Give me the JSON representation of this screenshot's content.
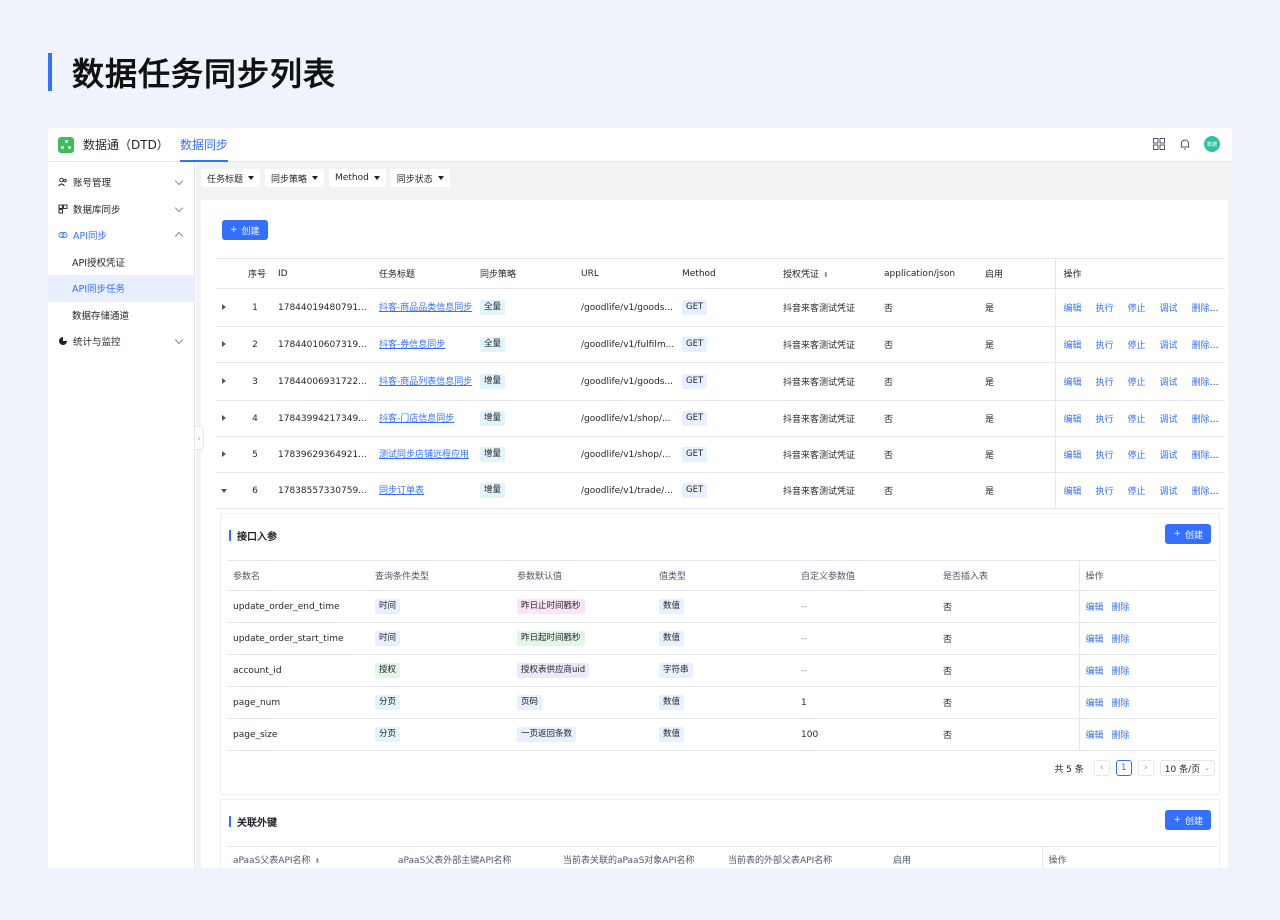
{
  "page_title": "数据任务同步列表",
  "app": {
    "name": "数据通（DTD）",
    "active_tab": "数据同步",
    "avatar_text": "数据"
  },
  "sidebar": {
    "items": [
      {
        "label": "账号管理",
        "icon": "users-icon",
        "expandable": true
      },
      {
        "label": "数据库同步",
        "icon": "database-icon",
        "expandable": true
      },
      {
        "label": "API同步",
        "icon": "api-icon",
        "expandable": true,
        "expanded": true
      },
      {
        "label": "API授权凭证",
        "sub": true
      },
      {
        "label": "API同步任务",
        "sub": true,
        "selected": true
      },
      {
        "label": "数据存储通道",
        "sub": true
      },
      {
        "label": "统计与监控",
        "icon": "chart-icon",
        "expandable": true
      }
    ]
  },
  "filters": [
    "任务标题",
    "同步策略",
    "Method",
    "同步状态"
  ],
  "create_label": "创建",
  "main_table": {
    "headers": [
      "序号",
      "ID",
      "任务标题",
      "同步策略",
      "URL",
      "Method",
      "授权凭证",
      "application/json",
      "启用",
      "操作"
    ],
    "actions": [
      "编辑",
      "执行",
      "停止",
      "调试",
      "删除"
    ],
    "rows": [
      {
        "no": "1",
        "id": "17844019480791...",
        "title": "抖客-商品品类信息同步",
        "strategy": "全量",
        "url": "/goodlife/v1/goods...",
        "method": "GET",
        "cred": "抖音来客测试凭证",
        "json": "否",
        "enabled": "是"
      },
      {
        "no": "2",
        "id": "17844010607319...",
        "title": "抖客-券信息同步",
        "strategy": "全量",
        "url": "/goodlife/v1/fulfilm...",
        "method": "GET",
        "cred": "抖音来客测试凭证",
        "json": "否",
        "enabled": "是"
      },
      {
        "no": "3",
        "id": "17844006931722...",
        "title": "抖客-商品列表信息同步",
        "strategy": "增量",
        "url": "/goodlife/v1/goods...",
        "method": "GET",
        "cred": "抖音来客测试凭证",
        "json": "否",
        "enabled": "是"
      },
      {
        "no": "4",
        "id": "17843994217349...",
        "title": "抖客-门店信息同步",
        "strategy": "增量",
        "url": "/goodlife/v1/shop/...",
        "method": "GET",
        "cred": "抖音来客测试凭证",
        "json": "否",
        "enabled": "是"
      },
      {
        "no": "5",
        "id": "17839629364921...",
        "title": "测试同步店铺远程应用",
        "strategy": "增量",
        "url": "/goodlife/v1/shop/...",
        "method": "GET",
        "cred": "抖音来客测试凭证",
        "json": "否",
        "enabled": "是"
      },
      {
        "no": "6",
        "id": "17838557330759...",
        "title": "同步订单表",
        "strategy": "增量",
        "url": "/goodlife/v1/trade/...",
        "method": "GET",
        "cred": "抖音来客测试凭证",
        "json": "否",
        "enabled": "是",
        "expanded": true
      }
    ]
  },
  "params": {
    "title": "接口入参",
    "headers": [
      "参数名",
      "查询条件类型",
      "参数默认值",
      "值类型",
      "自定义参数值",
      "是否插入表",
      "操作"
    ],
    "actions": [
      "编辑",
      "删除"
    ],
    "rows": [
      {
        "name": "update_order_end_time",
        "cond": "时间",
        "default": "昨日止时间戳秒",
        "vtype": "数值",
        "custom": "--",
        "insert": "否"
      },
      {
        "name": "update_order_start_time",
        "cond": "时间",
        "default": "昨日起时间戳秒",
        "vtype": "数值",
        "custom": "--",
        "insert": "否"
      },
      {
        "name": "account_id",
        "cond": "授权",
        "default": "授权表供应商uid",
        "vtype": "字符串",
        "custom": "--",
        "insert": "否"
      },
      {
        "name": "page_num",
        "cond": "分页",
        "default": "页码",
        "vtype": "数值",
        "custom": "1",
        "insert": "否"
      },
      {
        "name": "page_size",
        "cond": "分页",
        "default": "一页返回条数",
        "vtype": "数值",
        "custom": "100",
        "insert": "否"
      }
    ],
    "pager": {
      "total": "共 5 条",
      "current": "1",
      "size": "10 条/页"
    }
  },
  "foreign": {
    "title": "关联外键",
    "headers": [
      "aPaaS父表API名称",
      "aPaaS父表外部主键API名称",
      "当前表关联的aPaaS对象API名称",
      "当前表的外部父表API名称",
      "启用",
      "操作"
    ]
  }
}
